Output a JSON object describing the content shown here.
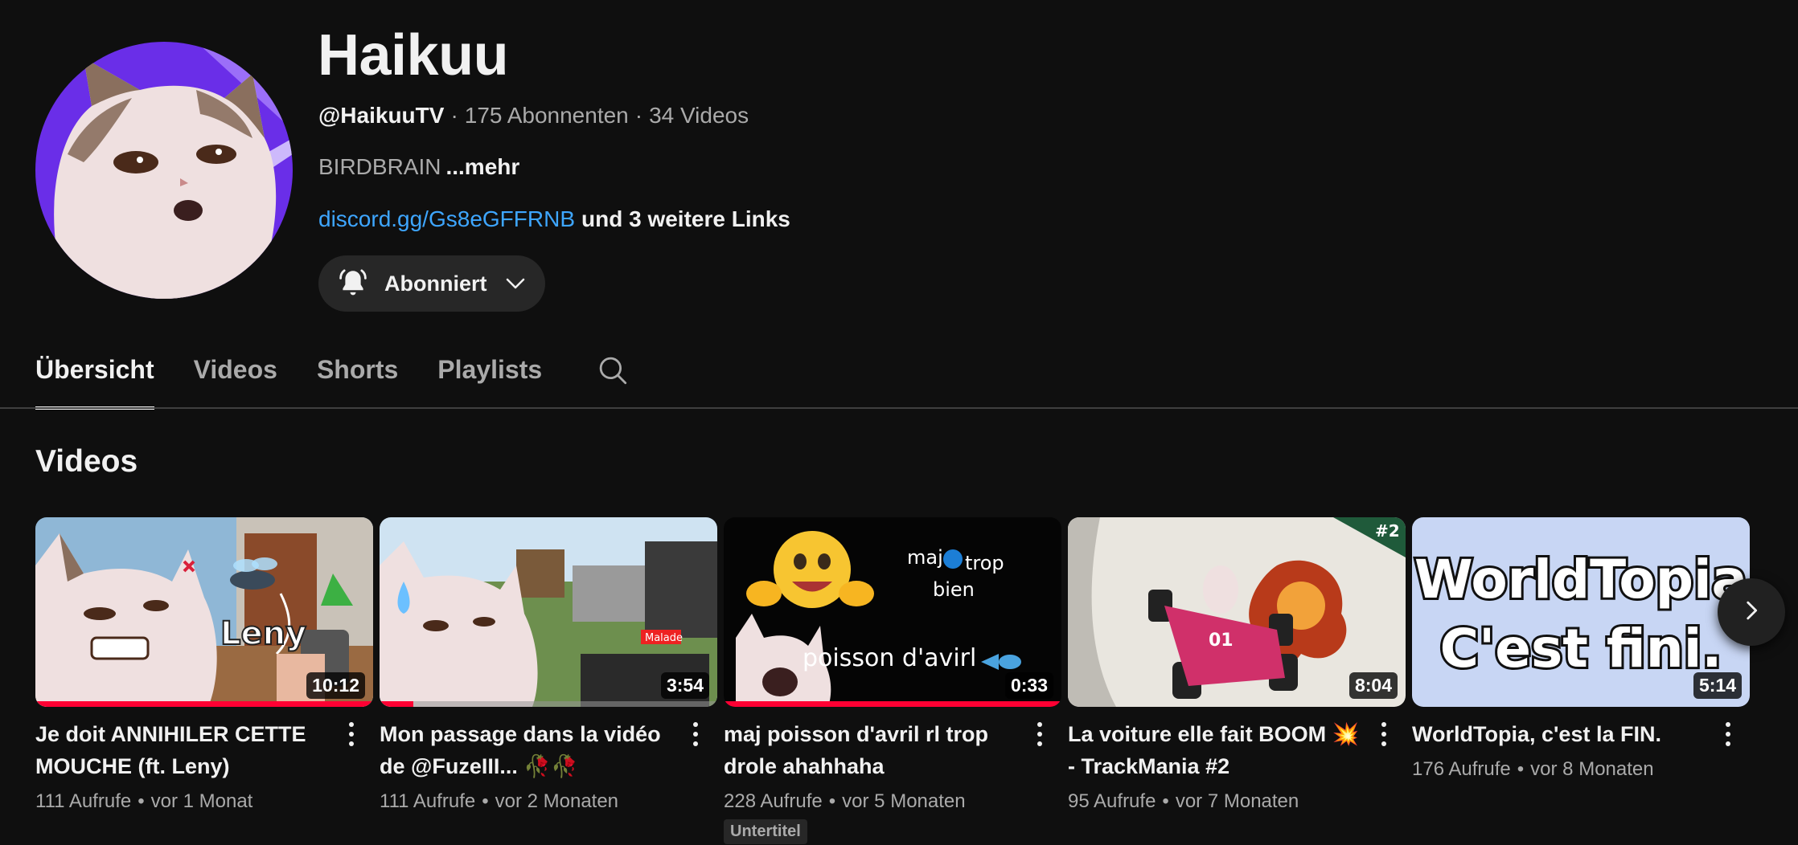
{
  "channel": {
    "name": "Haikuu",
    "handle": "@HaikuuTV",
    "subscribers": "175 Abonnenten",
    "video_count": "34 Videos",
    "description": "BIRDBRAIN",
    "more_label": "...mehr",
    "link_text": "discord.gg/Gs8eGFFRNB",
    "more_links": "und 3 weitere Links",
    "subscribe_label": "Abonniert",
    "avatar_icon": "cat-avatar-icon"
  },
  "tabs": [
    {
      "label": "Übersicht",
      "active": true
    },
    {
      "label": "Videos",
      "active": false
    },
    {
      "label": "Shorts",
      "active": false
    },
    {
      "label": "Playlists",
      "active": false
    }
  ],
  "section": {
    "title": "Videos"
  },
  "videos": [
    {
      "title": "Je doit ANNIHILER CETTE MOUCHE (ft. Leny)",
      "duration": "10:12",
      "views": "111 Aufrufe",
      "age": "vor 1 Monat",
      "watched_progress": 1.0,
      "thumb_text": "Leny"
    },
    {
      "title": "Mon passage dans la vidéo de @FuzeIII... 🥀🥀",
      "duration": "3:54",
      "views": "111 Aufrufe",
      "age": "vor 2 Monaten",
      "watched_progress": 0.1,
      "thumb_text": "Malade"
    },
    {
      "title": "maj poisson d'avril rl trop drole ahahhaha",
      "duration": "0:33",
      "views": "228 Aufrufe",
      "age": "vor 5 Monaten",
      "watched_progress": 1.0,
      "thumb_text_top": "maj",
      "thumb_text_top2": "trop",
      "thumb_text_mid": "bien",
      "thumb_text_bottom": "poisson d'avirl",
      "badge": "Untertitel"
    },
    {
      "title": "La voiture elle fait BOOM 💥 - TrackMania #2",
      "duration": "8:04",
      "views": "95 Aufrufe",
      "age": "vor 7 Monaten",
      "thumb_tag": "#2",
      "thumb_car_num": "01"
    },
    {
      "title": "WorldTopia, c'est la FIN.",
      "duration": "5:14",
      "views": "176 Aufrufe",
      "age": "vor 8 Monaten",
      "thumb_line1": "WorldTopia",
      "thumb_line2": "C'est fini."
    }
  ],
  "colors": {
    "background": "#0f0f0f",
    "link": "#3ea6ff",
    "progress": "#ff0033",
    "avatar_bg": "#7b2ff7"
  }
}
